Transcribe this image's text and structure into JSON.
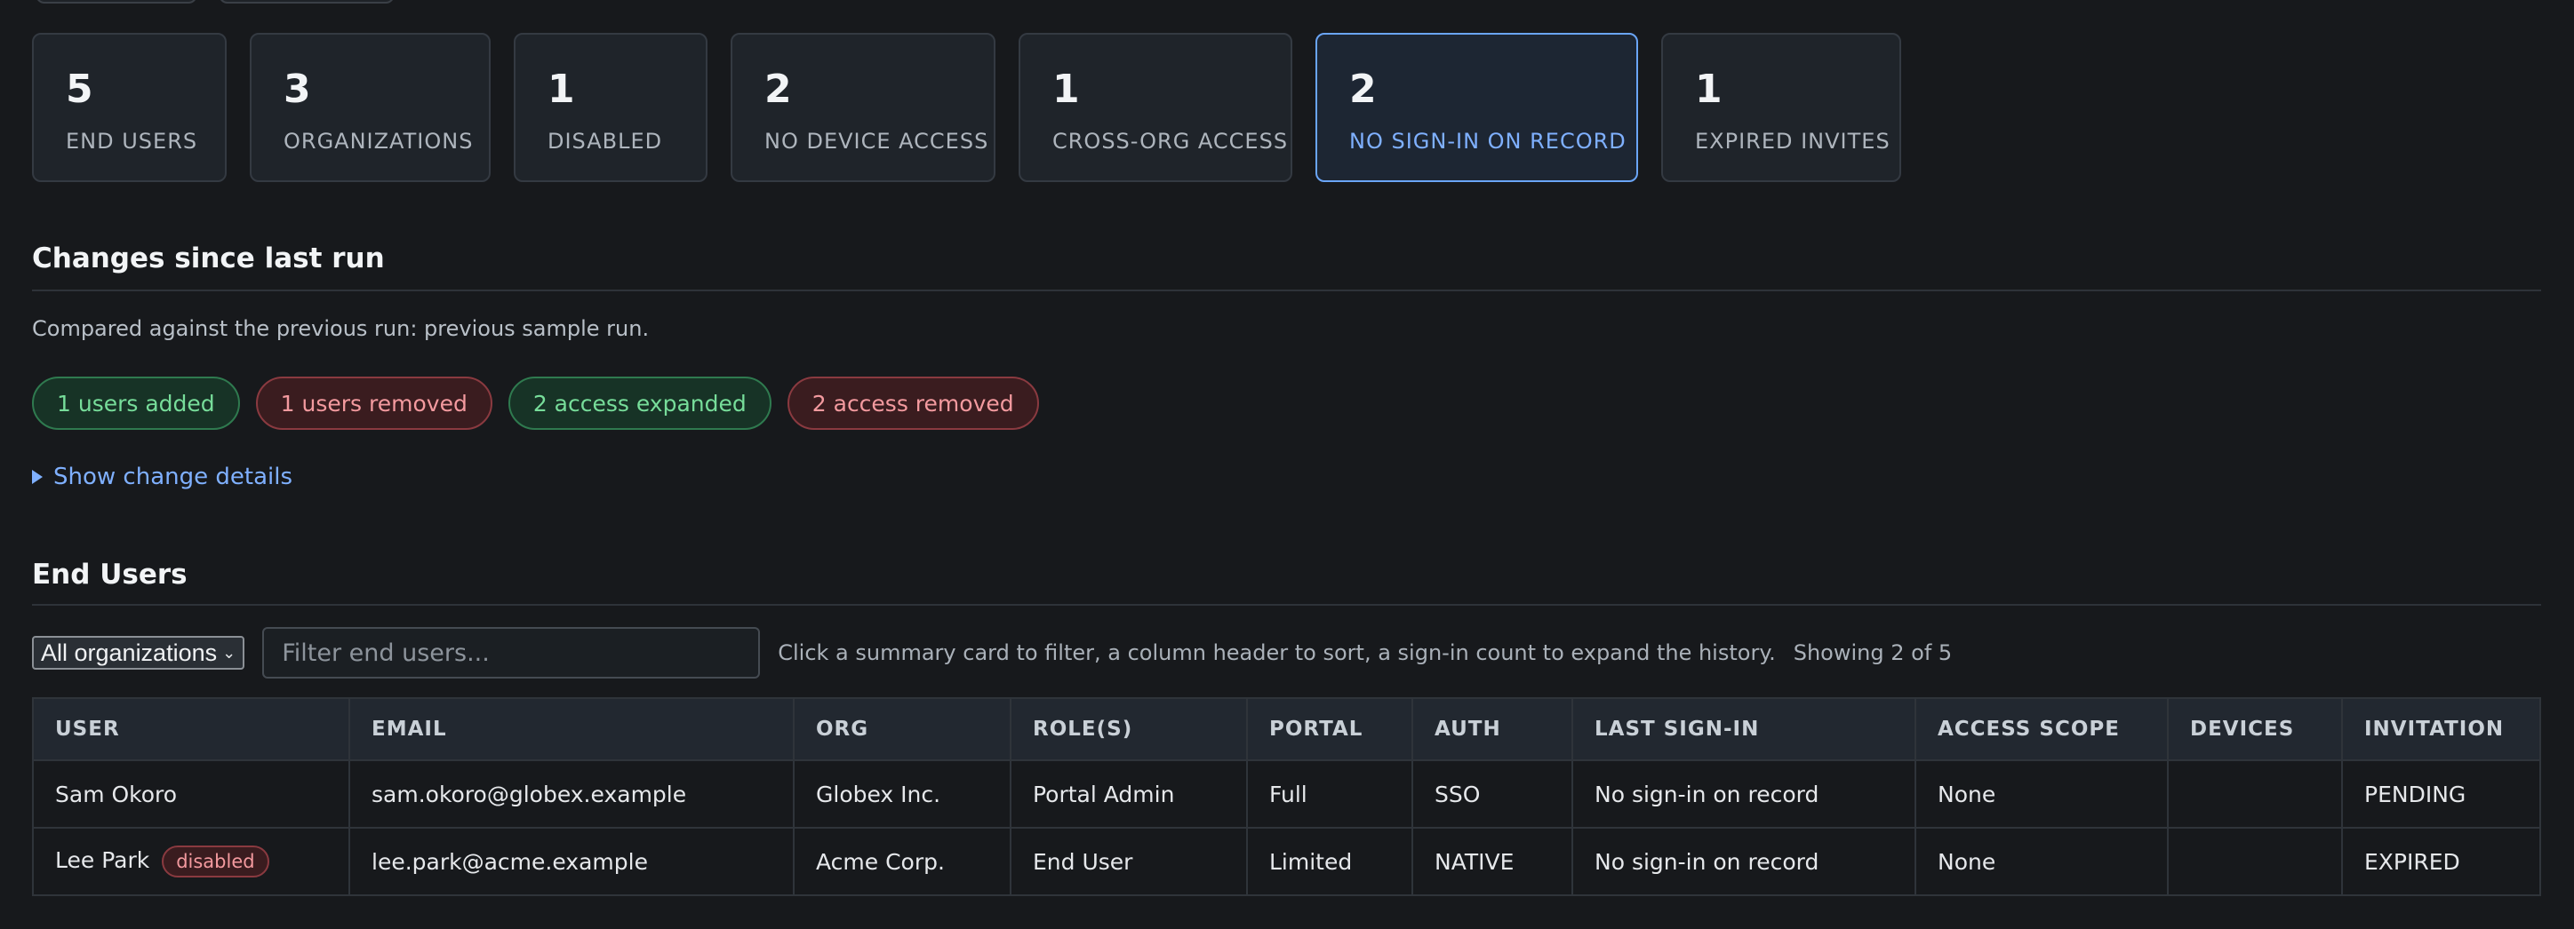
{
  "summary_cards": [
    {
      "value": "5",
      "label": "END USERS",
      "active": false
    },
    {
      "value": "3",
      "label": "ORGANIZATIONS",
      "active": false
    },
    {
      "value": "1",
      "label": "DISABLED",
      "active": false
    },
    {
      "value": "2",
      "label": "NO DEVICE ACCESS",
      "active": false
    },
    {
      "value": "1",
      "label": "CROSS-ORG ACCESS",
      "active": false
    },
    {
      "value": "2",
      "label": "NO SIGN-IN ON RECORD",
      "active": true
    },
    {
      "value": "1",
      "label": "EXPIRED INVITES",
      "active": false
    }
  ],
  "changes": {
    "title": "Changes since last run",
    "description": "Compared against the previous run: previous sample run.",
    "pills": [
      {
        "label": "1 users added",
        "tone": "green"
      },
      {
        "label": "1 users removed",
        "tone": "red"
      },
      {
        "label": "2 access expanded",
        "tone": "green"
      },
      {
        "label": "2 access removed",
        "tone": "red"
      }
    ],
    "details_link": "Show change details"
  },
  "end_users": {
    "title": "End Users",
    "org_select": "All organizations",
    "filter_placeholder": "Filter end users...",
    "hint": "Click a summary card to filter, a column header to sort, a sign-in count to expand the history.",
    "showing": "Showing 2 of 5",
    "columns": [
      "USER",
      "EMAIL",
      "ORG",
      "ROLE(S)",
      "PORTAL",
      "AUTH",
      "LAST SIGN-IN",
      "ACCESS SCOPE",
      "DEVICES",
      "INVITATION"
    ],
    "rows": [
      {
        "user": "Sam Okoro",
        "badge": "",
        "email": "sam.okoro@globex.example",
        "org": "Globex Inc.",
        "roles": "Portal Admin",
        "portal": "Full",
        "auth": "SSO",
        "last_signin": "No sign-in on record",
        "scope": "None",
        "devices": "",
        "invitation": "PENDING"
      },
      {
        "user": "Lee Park",
        "badge": "disabled",
        "email": "lee.park@acme.example",
        "org": "Acme Corp.",
        "roles": "End User",
        "portal": "Limited",
        "auth": "NATIVE",
        "last_signin": "No sign-in on record",
        "scope": "None",
        "devices": "",
        "invitation": "EXPIRED"
      }
    ]
  },
  "colors": {
    "background": "#17191c",
    "accent": "#7fb0ff",
    "warning": "#f0c06a",
    "success": "#77dd9a",
    "danger": "#f39a9f"
  }
}
